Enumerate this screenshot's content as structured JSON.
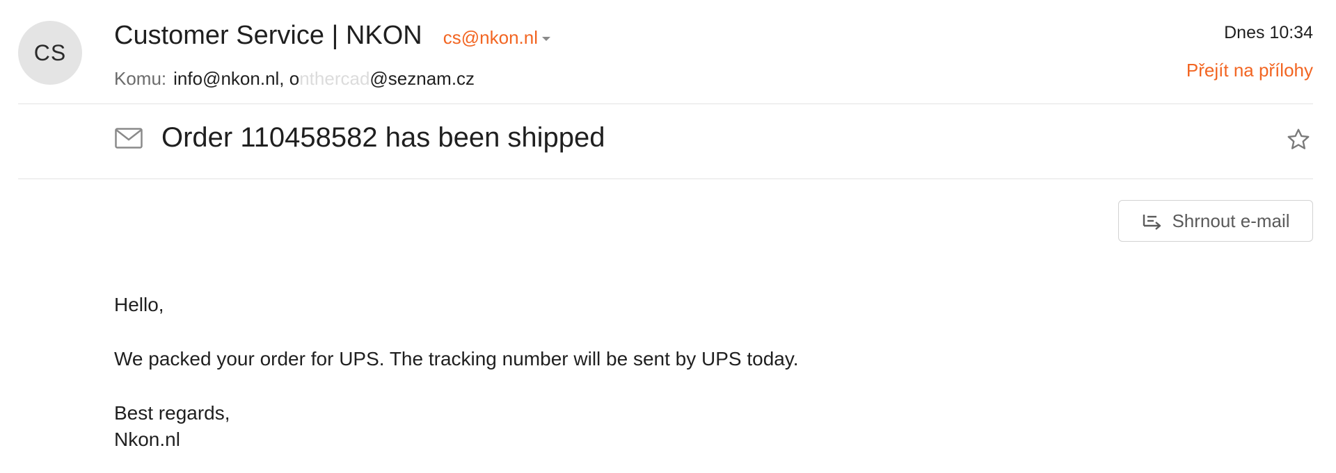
{
  "sender": {
    "initials": "CS",
    "name": "Customer Service | NKON",
    "email": "cs@nkon.nl"
  },
  "recipients": {
    "label": "Komu:",
    "value_visible_start": "info@nkon.nl, o",
    "value_obscured": "nthercad",
    "value_visible_end": "@seznam.cz"
  },
  "meta": {
    "date": "Dnes 10:34",
    "attachments_link": "Přejít na přílohy"
  },
  "subject": {
    "text": "Order 110458582 has been shipped",
    "icon": "envelope-icon"
  },
  "actions": {
    "star_icon": "star-outline-icon",
    "summarize_label": "Shrnout e-mail",
    "summarize_icon": "summarize-icon"
  },
  "body": {
    "greeting": "Hello,",
    "message": "We packed your order for UPS. The tracking number will be sent by UPS today.",
    "closing": "Best regards,",
    "signature": "Nkon.nl"
  },
  "colors": {
    "accent": "#f26522",
    "avatar_bg": "#e4e4e4",
    "divider": "#e3e3e3"
  }
}
